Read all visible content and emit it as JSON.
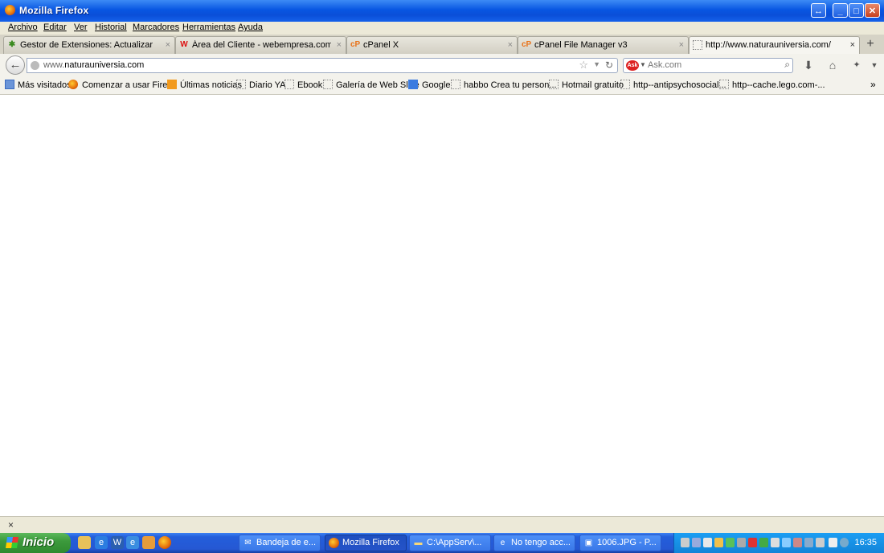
{
  "window": {
    "title": "Mozilla Firefox"
  },
  "menu": [
    "Archivo",
    "Editar",
    "Ver",
    "Historial",
    "Marcadores",
    "Herramientas",
    "Ayuda"
  ],
  "tabs": [
    {
      "label": "Gestor de Extensiones: Actualizar",
      "icon": "puzzle-icon"
    },
    {
      "label": "Área del Cliente - webempresa.com",
      "icon": "webempresa-icon"
    },
    {
      "label": "cPanel X",
      "icon": "cpanel-icon"
    },
    {
      "label": "cPanel File Manager v3",
      "icon": "cpanel-icon"
    },
    {
      "label": "http://www.naturauniversia.com/",
      "icon": "blank-page-icon"
    }
  ],
  "navbar": {
    "url_prefix": "www.",
    "url_domain": "naturauniversia.com",
    "search_placeholder": "Ask.com",
    "search_engine_label": "Ask"
  },
  "bookmarks": [
    "Más visitados",
    "Comenzar a usar Firef...",
    "Últimas noticias",
    "Diario YA",
    "Ebook",
    "Galería de Web Slice",
    "Google",
    "habbo Crea tu person...",
    "Hotmail gratuito",
    "http--antipsychosocial...",
    "http--cache.lego.com-..."
  ],
  "bookmarks_overflow": "»",
  "statusbar": {
    "close_glyph": "×"
  },
  "taskbar": {
    "start_label": "Inicio",
    "tasks": [
      "Bandeja de e...",
      "Mozilla Firefox",
      "C:\\AppServ\\...",
      "No tengo acc...",
      "1006.JPG - P..."
    ],
    "clock": "16:35"
  },
  "colors": {
    "xp_blue": "#245edb",
    "start_green": "#3c9a3c",
    "tray_blue": "#1384d8"
  }
}
